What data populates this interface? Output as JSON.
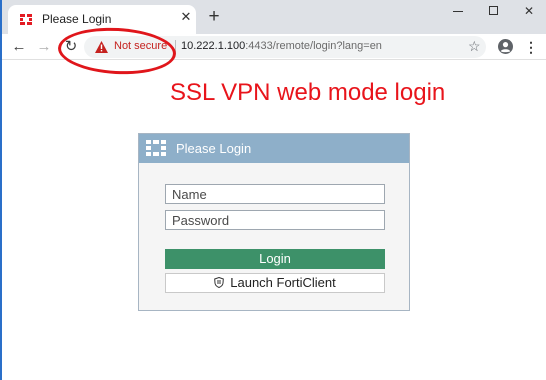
{
  "browser": {
    "tab": {
      "title": "Please Login",
      "favicon": "fortinet-logo-icon",
      "close_symbol": "✕"
    },
    "new_tab_symbol": "+",
    "window_controls": {
      "close_symbol": "✕"
    },
    "toolbar": {
      "back_symbol": "←",
      "forward_symbol": "→",
      "reload_symbol": "↻",
      "security_label": "Not secure",
      "url_host": "10.222.1.100",
      "url_rest": ":4433/remote/login?lang=en",
      "star_symbol": "☆",
      "menu_symbol": "⋮"
    }
  },
  "page": {
    "heading": "SSL VPN web mode login",
    "panel": {
      "title": "Please Login",
      "name_placeholder": "Name",
      "password_placeholder": "Password",
      "login_label": "Login",
      "launch_label": "Launch FortiClient"
    }
  },
  "colors": {
    "heading": "#e8141b",
    "annotation": "#e0161b",
    "panel_header": "#8eafc9",
    "login_button": "#3d9169",
    "not_secure": "#c5221f"
  }
}
